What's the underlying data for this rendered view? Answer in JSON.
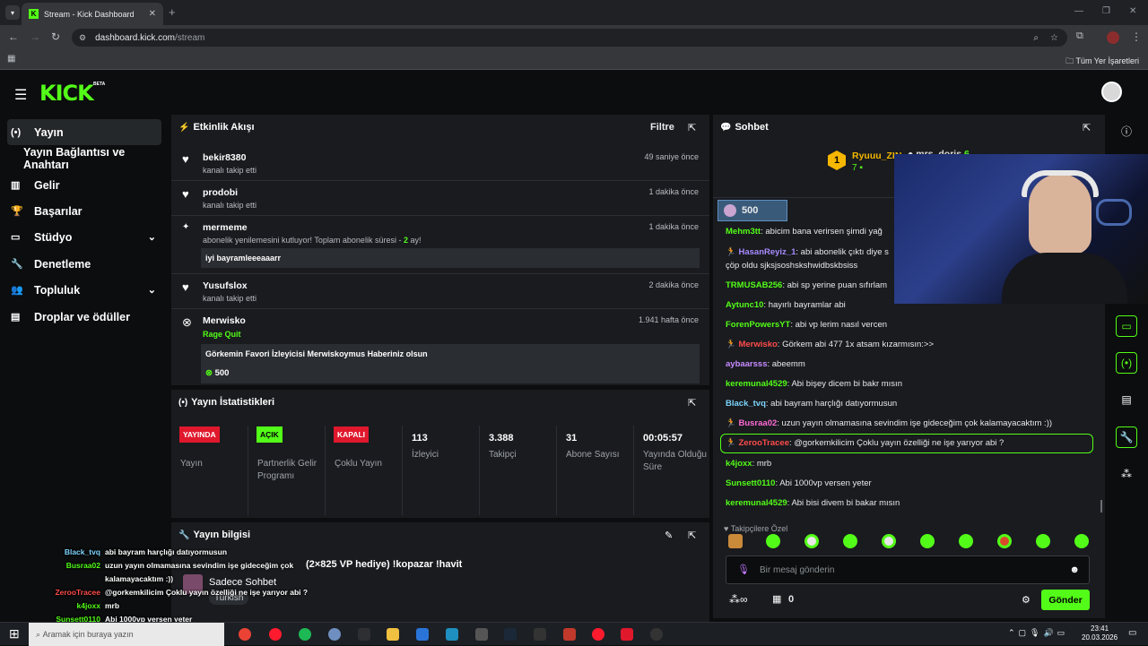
{
  "browser": {
    "tab_title": "Stream - Kick Dashboard",
    "favicon": "K",
    "url_host": "dashboard.kick.com",
    "url_path": "/stream",
    "bookmarks_label": "Tüm Yer İşaretleri"
  },
  "brand": {
    "logo": "KICK",
    "beta": "BETA",
    "accent": "#53fc18"
  },
  "sidebar": {
    "items": [
      {
        "label": "Yayın",
        "icon": "broadcast-icon"
      },
      {
        "label": "Yayın Bağlantısı ve Anahtarı",
        "icon": ""
      },
      {
        "label": "Gelir",
        "icon": "chart-icon"
      },
      {
        "label": "Başarılar",
        "icon": "trophy-icon"
      },
      {
        "label": "Stüdyo",
        "icon": "studio-icon"
      },
      {
        "label": "Denetleme",
        "icon": "wrench-icon"
      },
      {
        "label": "Topluluk",
        "icon": "community-icon"
      },
      {
        "label": "Droplar ve ödüller",
        "icon": "drops-icon"
      }
    ]
  },
  "activity": {
    "title": "Etkinlik Akışı",
    "filter": "Filtre",
    "events": [
      {
        "user": "bekir8380",
        "sub": "kanalı takip etti",
        "time": "49 saniye önce"
      },
      {
        "user": "prodobi",
        "sub": "kanalı takip etti",
        "time": "1 dakika önce"
      },
      {
        "user": "mermeme",
        "sub_pre": "abonelik yenilemesini kutluyor! Toplam abonelik süresi -",
        "sub_num": "2",
        "sub_post": "ay!",
        "message": "iyi bayramleeeaaarr",
        "time": "1 dakika önce"
      },
      {
        "user": "Yusufslox",
        "sub": "kanalı takip etti",
        "time": "2 dakika önce"
      },
      {
        "user": "Merwisko",
        "sub": "Rage Quit",
        "message": "Görkemin Favori İzleyicisi Merwiskoymus Haberiniz olsun",
        "amount": "500",
        "time": "1.941 hafta önce"
      }
    ]
  },
  "stats": {
    "title": "Yayın İstatistikleri",
    "items": [
      {
        "badge": "YAYINDA",
        "label": "Yayın"
      },
      {
        "badge": "AÇIK",
        "label": "Partnerlik Gelir Programı"
      },
      {
        "badge": "KAPALI",
        "label": "Çoklu Yayın"
      },
      {
        "value": "113",
        "label": "İzleyici"
      },
      {
        "value": "3.388",
        "label": "Takipçi"
      },
      {
        "value": "31",
        "label": "Abone Sayısı"
      },
      {
        "value": "00:05:57",
        "label": "Yayında Olduğu Süre"
      }
    ]
  },
  "info": {
    "title": "Yayın bilgisi",
    "stream_title": "!kopazar !havit",
    "stream_title_prefix": "(2×825 VP hediye)",
    "chat_mode": "Sadece Sohbet",
    "language": "Turkish"
  },
  "chat": {
    "title": "Sohbet",
    "top_gifter": "Ryuuu_ZIN",
    "top_gifter_count": "7",
    "second_gifter": "mrs_doris",
    "second_count": "6",
    "pinned_amount": "500",
    "messages": [
      {
        "user": "Mehm3tt",
        "text": "abicim bana verirsen şimdi yağ",
        "color": "#53fc18"
      },
      {
        "user": "HasanReyiz_1",
        "text": "abi abonelik çıktı diye s",
        "text2": "çöp oldu sjksjsoshskshwidbskbsiss",
        "color": "#a98bff",
        "badge": true
      },
      {
        "user": "TRMUSAB256",
        "text": "abi sp yerine puan sıfırlam",
        "color": "#53fc18"
      },
      {
        "user": "Aytunc10",
        "text": "hayırlı bayramlar abi",
        "color": "#53fc18"
      },
      {
        "user": "ForenPowersYT",
        "text": "abi vp lerim nasıl vercen",
        "color": "#53fc18"
      },
      {
        "user": "Merwisko",
        "text": "Görkem abi 477 1x atsam kızarmısın:>>",
        "color": "#ff4b4b",
        "badge": true
      },
      {
        "user": "aybaarsss",
        "text": "abeemm",
        "color": "#c78bff"
      },
      {
        "user": "keremunal4529",
        "text": "Abi bişey dicem bi bakr mısın",
        "color": "#53fc18"
      },
      {
        "user": "Black_tvq",
        "text": "abi bayram harçlığı datıyormusun",
        "color": "#7dd3fc"
      },
      {
        "user": "Busraa02",
        "text": "uzun yayın olmamasına sevindim işe gideceğim çok kalamayacaktım :))",
        "color": "#ff6bd6",
        "badge": true
      },
      {
        "user": "ZerooTracee",
        "text": "@gorkemkilicim Çoklu yayın özelliği ne işe yarıyor abi ?",
        "color": "#ff4b4b",
        "badge": true,
        "highlight": true
      },
      {
        "user": "k4joxx",
        "text": "mrb",
        "color": "#53fc18"
      },
      {
        "user": "Sunsett0110",
        "text": "Abi 1000vp versen yeter",
        "color": "#53fc18"
      },
      {
        "user": "keremunal4529",
        "text": "Abi bisi divem bi bakar mısın",
        "color": "#53fc18"
      }
    ],
    "followers_only": "Takipçilere Özel",
    "placeholder": "Bir mesaj gönderin",
    "points": "0",
    "send": "Gönder"
  },
  "overlay": [
    {
      "user": "Black_tvq",
      "text": "abi bayram harçlığı datıyormusun",
      "color": "#7dd3fc"
    },
    {
      "user": "Busraa02",
      "text": "uzun yayın olmamasına sevindim işe gideceğim çok",
      "color": "#53fc18"
    },
    {
      "user": "",
      "text": "kalamayacaktım :))",
      "color": "#53fc18"
    },
    {
      "user": "ZerooTracee",
      "text": "@gorkemkilicim Çoklu yayın özelliği ne işe yarıyor abi ?",
      "color": "#ff4b4b"
    },
    {
      "user": "k4joxx",
      "text": "mrb",
      "color": "#53fc18"
    },
    {
      "user": "Sunsett0110",
      "text": "Abi 1000vp versen yeter",
      "color": "#53fc18"
    }
  ],
  "taskbar": {
    "search": "Aramak için buraya yazın",
    "time": "23:41",
    "date": "20.03.2026"
  }
}
